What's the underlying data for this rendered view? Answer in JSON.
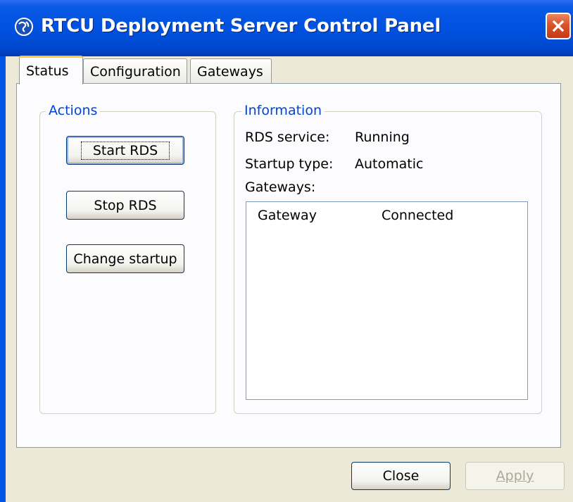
{
  "window": {
    "title": "RTCU Deployment Server Control Panel",
    "icon": "globe-icon",
    "close_icon": "close-x-icon"
  },
  "tabs": [
    {
      "label": "Status",
      "selected": true
    },
    {
      "label": "Configuration",
      "selected": false
    },
    {
      "label": "Gateways",
      "selected": false
    }
  ],
  "actions": {
    "legend": "Actions",
    "start_label": "Start RDS",
    "stop_label": "Stop RDS",
    "change_label": "Change startup"
  },
  "information": {
    "legend": "Information",
    "service_label": "RDS service:",
    "service_value": "Running",
    "startup_label": "Startup type:",
    "startup_value": "Automatic",
    "gateways_label": "Gateways:",
    "gateway_list": {
      "columns": [
        "Gateway",
        "Connected"
      ],
      "rows": []
    }
  },
  "footer": {
    "close_label": "Close",
    "apply_label": "Apply"
  },
  "colors": {
    "titlebar": "#0052E0",
    "tab_highlight": "#FFC83C",
    "group_legend": "#0046D5"
  }
}
